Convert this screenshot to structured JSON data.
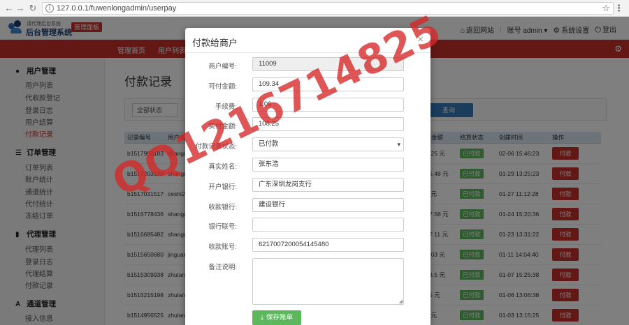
{
  "browser": {
    "url": "127.0.0.1/fuwenlongadmin/userpay"
  },
  "header": {
    "logo_small": "请代理后台系统",
    "logo_text": "后台管理系统",
    "badge": "管理面板",
    "return_site": "返回网站",
    "account": "账号 admin",
    "settings": "系统设置",
    "logout": "登出"
  },
  "menubar": {
    "items": [
      "管理首页",
      "用户列表"
    ]
  },
  "sidebar": {
    "groups": [
      {
        "title": "用户管理",
        "icon": "user-icon",
        "items": [
          "用户列表",
          "代收款登记",
          "登录日志",
          "用户结算",
          "付款记录"
        ]
      },
      {
        "title": "订单管理",
        "icon": "list-icon",
        "items": [
          "订单列表",
          "账户统计",
          "通道统计",
          "代付统计",
          "冻结订单"
        ]
      },
      {
        "title": "代理管理",
        "icon": "file-icon",
        "items": [
          "代理列表",
          "登录日志",
          "代理结算",
          "付款记录"
        ]
      },
      {
        "title": "通道管理",
        "icon": "font-icon",
        "items": [
          "接入信息"
        ]
      }
    ],
    "active": "付款记录"
  },
  "main": {
    "title": "付款记录",
    "filter_status": "全部状态",
    "search_btn": "查询",
    "columns": [
      "记录编号",
      "用户名",
      "实付金额",
      "结算状态",
      "创建时间",
      "操作"
    ],
    "rows": [
      {
        "id": "b1517903183",
        "user": "shangu",
        "amount": "108.25 元",
        "status": "已付款",
        "time": "02-06 15:46:23",
        "action": "付款"
      },
      {
        "id": "b1517203523",
        "user": "shangu",
        "amount": "3675.48 元",
        "status": "已付款",
        "time": "01-29 13:25:23",
        "action": "付款"
      },
      {
        "id": "b1517031517",
        "user": "ceshi2",
        "amount": "990 元",
        "status": "已付款",
        "time": "01-27 11:12:28",
        "action": "付款"
      },
      {
        "id": "b1516778436",
        "user": "shangu",
        "amount": "2867.58 元",
        "status": "已付款",
        "time": "01-24 15:20:36",
        "action": "付款"
      },
      {
        "id": "b1516685482",
        "user": "shangu",
        "amount": "2107.11 元",
        "status": "已付款",
        "time": "01-23 13:31:22",
        "action": "付款"
      },
      {
        "id": "b1515650680",
        "user": "jinguan",
        "amount": "195.03 元",
        "status": "已付款",
        "time": "01-11 14:04:40",
        "action": "付款"
      },
      {
        "id": "b1515309938",
        "user": "zhulan",
        "amount": "3028.5 元",
        "status": "已付款",
        "time": "01-07 15:25:38",
        "action": "付款"
      },
      {
        "id": "b1515215198",
        "user": "zhulan",
        "amount": "9825 元",
        "status": "已付款",
        "time": "01-06 13:06:38",
        "action": "付款"
      },
      {
        "id": "b1514956525",
        "user": "zhulan",
        "amount": "985 元",
        "status": "已付款",
        "time": "01-03 13:15:25",
        "action": "付款"
      }
    ]
  },
  "modal": {
    "title": "付款给商户",
    "close": "×",
    "fields": {
      "merchant_id": {
        "label": "商户编号:",
        "value": "11009"
      },
      "payable": {
        "label": "可付金额:",
        "value": "109.34"
      },
      "fee": {
        "label": "手续费:",
        "value": "1.09"
      },
      "actual": {
        "label": "实付金额:",
        "value": "108.25"
      },
      "status": {
        "label": "付款记录状态:",
        "value": "已付款"
      },
      "real_name": {
        "label": "真实姓名:",
        "value": "张东浩"
      },
      "bank_branch": {
        "label": "开户银行:",
        "value": "广东深圳龙岗支行"
      },
      "bank": {
        "label": "收款银行:",
        "value": "建设银行"
      },
      "bank_code": {
        "label": "银行联号:",
        "value": ""
      },
      "account_no": {
        "label": "收款账号:",
        "value": "6217007200054145480"
      },
      "remark": {
        "label": "备注说明:",
        "value": ""
      }
    },
    "save_btn": "保存账单"
  },
  "watermark": "QQ1216714825"
}
